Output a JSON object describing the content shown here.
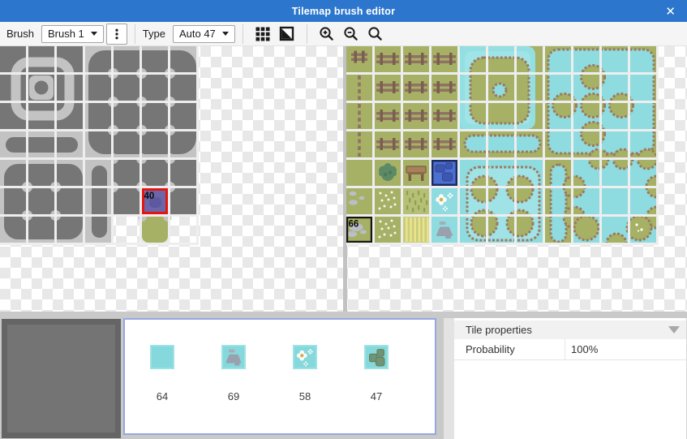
{
  "title_bar": {
    "title": "Tilemap brush editor",
    "close_icon": "✕"
  },
  "toolbar": {
    "brush_label": "Brush",
    "brush_value": "Brush 1",
    "type_label": "Type",
    "type_value": "Auto 47",
    "icons": {
      "menu": "kebab-vertical-dots",
      "grid": "grid-3x3",
      "mask": "diagonal-half-square",
      "zoom_in": "magnifier-plus",
      "zoom_out": "magnifier-minus",
      "zoom_reset": "magnifier"
    }
  },
  "left_tileset": {
    "selected_tile_label": "40",
    "grid": [
      [
        "d",
        "d",
        "d",
        "l",
        "l",
        "l",
        "l"
      ],
      [
        "d",
        "d",
        "d",
        "l",
        "l",
        "l",
        "l"
      ],
      [
        "d",
        "d",
        "d",
        "l",
        "l",
        "l",
        "l"
      ],
      [
        "l",
        "l",
        "l",
        "l",
        "l",
        "l",
        "l"
      ],
      [
        "l",
        "l",
        "l",
        "l",
        "d",
        "d",
        "d"
      ],
      [
        "l",
        "l",
        "l",
        "l",
        "d",
        "S",
        "d"
      ],
      [
        "l",
        "l",
        "l",
        "l",
        ".",
        "n",
        "."
      ]
    ]
  },
  "right_tileset": {
    "marked_tile_label": "66",
    "grid": [
      [
        "g",
        "g",
        "g",
        "g",
        "w",
        "w",
        "g",
        "g",
        "g",
        "g",
        "g"
      ],
      [
        "g",
        "g",
        "g",
        "g",
        "w",
        "w",
        "g",
        "g",
        "g",
        "g",
        "g"
      ],
      [
        "g",
        "g",
        "g",
        "g",
        "w",
        "w",
        "g",
        "g",
        "g",
        "g",
        "g"
      ],
      [
        "g",
        "g",
        "g",
        "g",
        "g",
        "g",
        "g",
        "g",
        "g",
        "g",
        "g"
      ],
      [
        "g",
        "g",
        "g",
        "B",
        "w",
        "w",
        "w",
        "g",
        "w",
        "w",
        "w"
      ],
      [
        "g",
        "g",
        "g",
        "w",
        "w",
        "w",
        "w",
        "g",
        "w",
        "w",
        "w"
      ],
      [
        "g",
        "g",
        "g",
        "w",
        "w",
        "w",
        "w",
        "g",
        "w",
        "w",
        "w"
      ]
    ],
    "decals": [
      {
        "c": 0,
        "r": 0,
        "t": "fence-s"
      },
      {
        "c": 1,
        "r": 0,
        "t": "fence-h"
      },
      {
        "c": 2,
        "r": 0,
        "t": "fence-h"
      },
      {
        "c": 3,
        "r": 0,
        "t": "fence-h"
      },
      {
        "c": 0,
        "r": 1,
        "t": "fence-v"
      },
      {
        "c": 1,
        "r": 1,
        "t": "fence-h"
      },
      {
        "c": 2,
        "r": 1,
        "t": "fence-h"
      },
      {
        "c": 3,
        "r": 1,
        "t": "fence-h"
      },
      {
        "c": 0,
        "r": 2,
        "t": "fence-v"
      },
      {
        "c": 1,
        "r": 2,
        "t": "fence-h"
      },
      {
        "c": 2,
        "r": 2,
        "t": "fence-h"
      },
      {
        "c": 3,
        "r": 2,
        "t": "fence-h"
      },
      {
        "c": 0,
        "r": 3,
        "t": "fence-v"
      },
      {
        "c": 1,
        "r": 3,
        "t": "fence-h"
      },
      {
        "c": 2,
        "r": 3,
        "t": "fence-h"
      },
      {
        "c": 3,
        "r": 3,
        "t": "fence-h"
      },
      {
        "c": 1,
        "r": 4,
        "t": "bush"
      },
      {
        "c": 2,
        "r": 4,
        "t": "table"
      },
      {
        "c": 3,
        "r": 4,
        "t": "blue-rocks"
      },
      {
        "c": 0,
        "r": 5,
        "t": "rocks-sm"
      },
      {
        "c": 1,
        "r": 5,
        "t": "specks"
      },
      {
        "c": 2,
        "r": 5,
        "t": "tallgrass"
      },
      {
        "c": 3,
        "r": 5,
        "t": "wflowers"
      },
      {
        "c": 0,
        "r": 6,
        "t": "rocks-lg"
      },
      {
        "c": 1,
        "r": 6,
        "t": "specks"
      },
      {
        "c": 2,
        "r": 6,
        "t": "ystripes"
      },
      {
        "c": 3,
        "r": 6,
        "t": "wrocks"
      }
    ]
  },
  "selection_panel": {
    "tiles": [
      {
        "label": "64",
        "art": "plain-water"
      },
      {
        "label": "69",
        "art": "water-gray-rocks"
      },
      {
        "label": "58",
        "art": "water-flowers"
      },
      {
        "label": "47",
        "art": "water-green-rocks"
      }
    ]
  },
  "properties_panel": {
    "header": "Tile properties",
    "rows": [
      {
        "label": "Probability",
        "value": "100%"
      }
    ]
  },
  "colors": {
    "titlebar": "#2d76cd",
    "grass": "#a6b165",
    "water": "#8edce0",
    "gray_dark": "#767676",
    "gray_light": "#c3c3c3",
    "selected_fill": "#6b66a8",
    "selection_red": "#e41511",
    "selection_blue": "#1c2a5e",
    "blue_tile_bg": "#4a70d0",
    "pond_edge": "#9b7a61"
  }
}
